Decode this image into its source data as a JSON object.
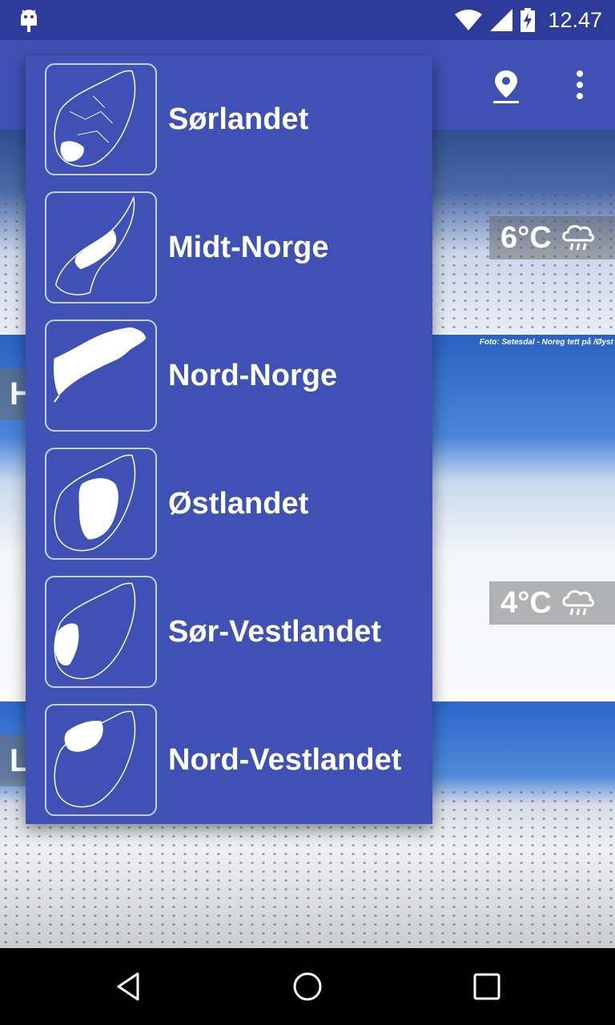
{
  "status_bar": {
    "time": "12.47",
    "icons": [
      "android-icon",
      "wifi-icon",
      "signal-icon",
      "battery-charging-icon"
    ]
  },
  "toolbar": {
    "icons": [
      "location-pin-icon",
      "overflow-menu-icon"
    ]
  },
  "cards": [
    {
      "temperature": "6°C",
      "weather_icon": "rain-cloud-icon"
    },
    {
      "temperature": "4°C",
      "weather_icon": "rain-cloud-icon",
      "photo_credit": "Foto: Setesdal - Noreg tett på /Øyst",
      "side_letter": "H"
    },
    {
      "side_letter": "L"
    }
  ],
  "region_menu": {
    "items": [
      {
        "label": "Sørlandet",
        "icon": "norway-map-sorlandet-icon"
      },
      {
        "label": "Midt-Norge",
        "icon": "norway-map-midt-norge-icon"
      },
      {
        "label": "Nord-Norge",
        "icon": "norway-map-nord-norge-icon"
      },
      {
        "label": "Østlandet",
        "icon": "norway-map-ostlandet-icon"
      },
      {
        "label": "Sør-Vestlandet",
        "icon": "norway-map-sor-vestlandet-icon"
      },
      {
        "label": "Nord-Vestlandet",
        "icon": "norway-map-nord-vestlandet-icon"
      }
    ]
  },
  "nav_bar": {
    "icons": [
      "back-icon",
      "home-icon",
      "recents-icon"
    ]
  },
  "colors": {
    "primary": "#3f51b5",
    "primary_dark": "#2f3b9a"
  }
}
